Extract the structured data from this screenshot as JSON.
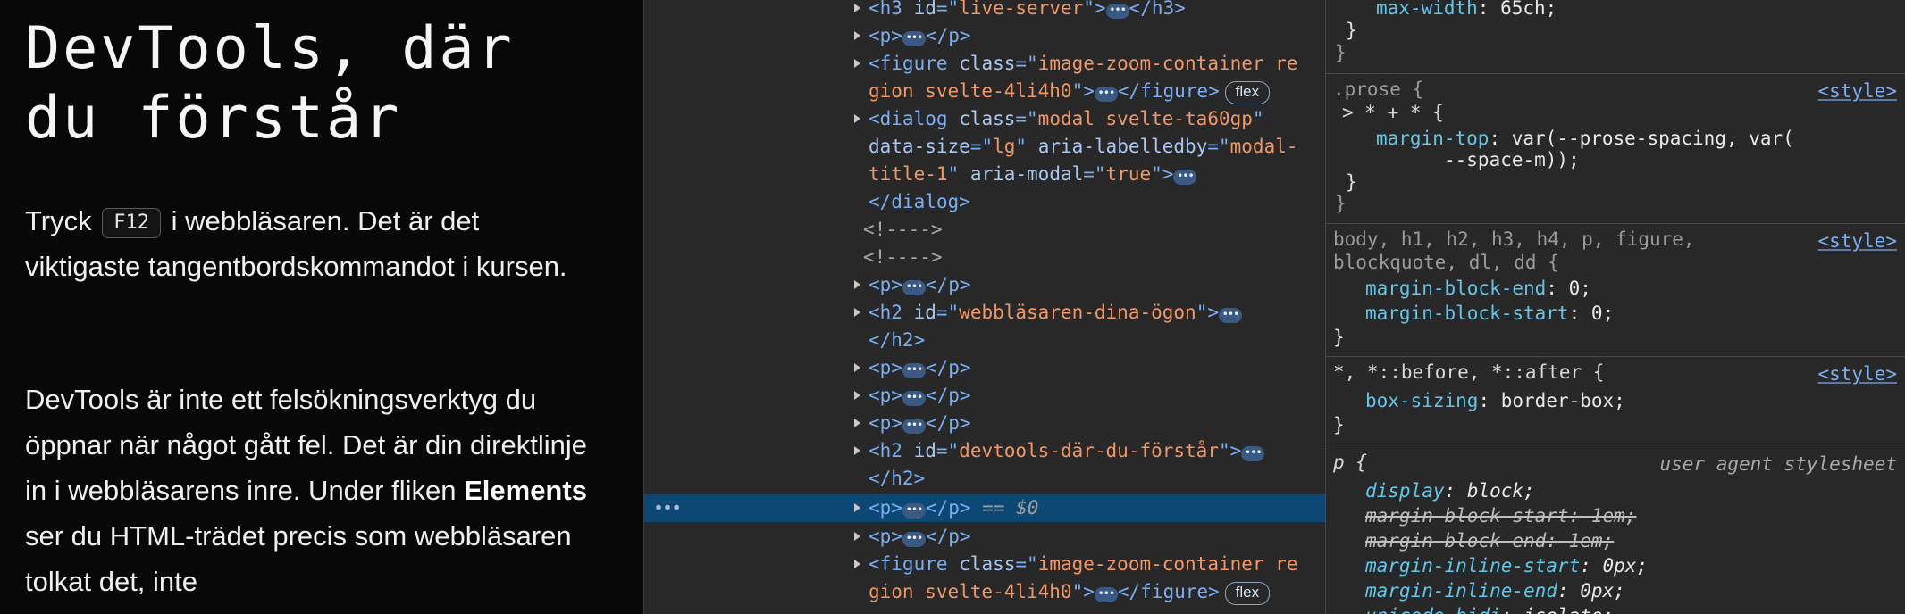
{
  "article": {
    "title": "DevTools, där\ndu förstår",
    "p1_pre": "Tryck",
    "p1_key": "F12",
    "p1_post": "i webbläsaren. Det är det viktigaste tangentbordskommandot i kursen.",
    "p2_pre": "DevTools är inte ett felsökningsverktyg du öppnar när något gått fel. Det är din direktlinje in i webbläsarens inre. Under fliken",
    "p2_bold": "Elements",
    "p2_post": "ser du HTML-trädet precis som webbläsaren tolkat det, inte"
  },
  "elements_panel": {
    "h3_id": "live-server",
    "fig_class_a": "image-zoom-container re",
    "fig_class_b": "gion svelte-4li4h0",
    "flex_badge": "flex",
    "dialog_class": "modal svelte-ta60gp",
    "dialog_size": "lg",
    "dialog_labelledby_a": "modal-",
    "dialog_labelledby_b": "title-1",
    "dialog_modal": "true",
    "comment": "<!---->",
    "h2_id_1": "webbläsaren-dina-ögon",
    "h2_id_2": "devtools-där-du-förstår",
    "selected_marker": "== $0",
    "ellipsis": "•••"
  },
  "styles_panel": {
    "r0_prop": "max-width",
    "r0_val": "65ch",
    "r1_selector": ".prose {",
    "r1_selector2": "> * + * {",
    "r1_prop": "margin-top",
    "r1_val_a": "var(--prose-spacing, var(",
    "r1_val_b": "--space-m));",
    "r2_selector_a": "body, h1, h2, h3, h4, p, figure,",
    "r2_selector_b": "blockquote, dl, dd {",
    "r2_prop1": "margin-block-end",
    "r2_val1": "0",
    "r2_prop2": "margin-block-start",
    "r2_val2": "0",
    "r3_selector": "*, *::before, *::after {",
    "r3_prop": "box-sizing",
    "r3_val": "border-box",
    "r4_selector": "p {",
    "r4_source": "user agent stylesheet",
    "r4_props": [
      {
        "prop": "display",
        "val": "block"
      },
      {
        "prop": "margin-block-start",
        "val": "1em"
      },
      {
        "prop": "margin-block-end",
        "val": "1em"
      },
      {
        "prop": "margin-inline-start",
        "val": "0px"
      },
      {
        "prop": "margin-inline-end",
        "val": "0px"
      },
      {
        "prop": "unicode-bidi",
        "val": "isolate"
      }
    ],
    "style_source": "<style>"
  }
}
